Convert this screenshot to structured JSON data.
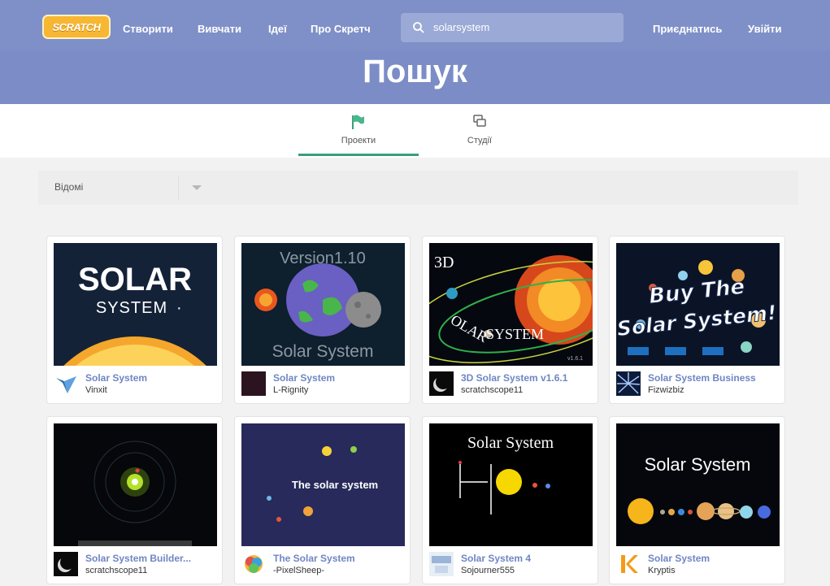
{
  "nav": {
    "logo_text": "SCRATCH",
    "links": [
      "Створити",
      "Вивчати",
      "Ідеї",
      "Про Скретч"
    ],
    "search_value": "solarsystem",
    "join": "Приєднатись",
    "sign_in": "Увійти"
  },
  "hero": {
    "title": "Пошук"
  },
  "tabs": [
    {
      "label": "Проекти",
      "icon": "flag-icon",
      "active": true
    },
    {
      "label": "Студії",
      "icon": "studio-icon",
      "active": false
    }
  ],
  "filter": {
    "selected": "Відомі"
  },
  "colors": {
    "nav": "#7f90c8",
    "hero": "#7b8cc6",
    "link": "#6f86c4",
    "active_tab": "#3b9e79"
  },
  "projects": [
    {
      "title": "Solar System",
      "author": "Vinxit",
      "thumb_text": "SOLAR SYSTEM"
    },
    {
      "title": "Solar System",
      "author": "L-Rignity",
      "thumb_text": "Version1.10 Solar System"
    },
    {
      "title": "3D Solar System v1.6.1",
      "author": "scratchscope11",
      "thumb_text": "3D SOLAR SYSTEM v1.6.1"
    },
    {
      "title": "Solar System Business",
      "author": "Fizwizbiz",
      "thumb_text": "Buy The Solar System!"
    },
    {
      "title": "Solar System Builder...",
      "author": "scratchscope11",
      "thumb_text": ""
    },
    {
      "title": "The Solar System",
      "author": "-PixelSheep-",
      "thumb_text": "The solar system"
    },
    {
      "title": "Solar System 4",
      "author": "Sojourner555",
      "thumb_text": "Solar System"
    },
    {
      "title": "Solar System",
      "author": "Kryptis",
      "thumb_text": "Solar System"
    }
  ]
}
